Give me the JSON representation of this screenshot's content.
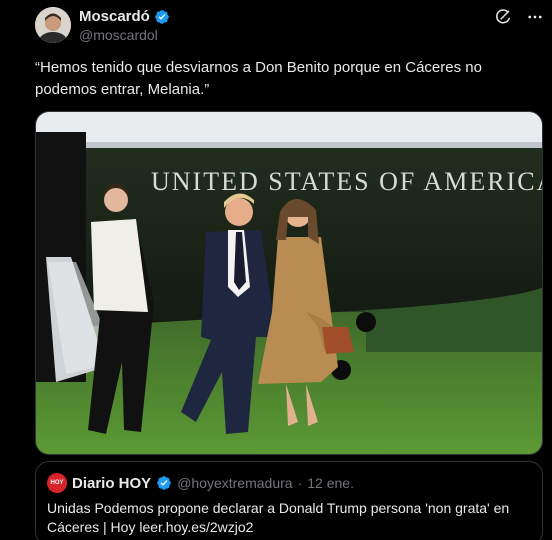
{
  "author": {
    "display_name": "Moscardó",
    "handle": "@moscardol",
    "verified": true
  },
  "tweet": {
    "text": "“Hemos tenido que desviarnos a Don Benito porque en Cáceres no podemos entrar, Melania.”"
  },
  "media": {
    "helicopter_lettering": "UNITED STATES OF AMERICA"
  },
  "quoted": {
    "logo_text": "HOY",
    "name": "Diario HOY",
    "verified": true,
    "handle": "@hoyextremadura",
    "separator": "·",
    "date": "12 ene.",
    "text": "Unidas Podemos propone declarar a Donald Trump persona 'non grata' en Cáceres | Hoy leer.hoy.es/2wzjo2"
  },
  "icons": {
    "top_right": [
      "grok-icon",
      "more-icon"
    ],
    "verified": "verified-badge-icon"
  },
  "colors": {
    "background": "#000000",
    "text": "#e7e9ea",
    "muted": "#71767b",
    "verified": "#1d9bf0",
    "border": "#2f3336",
    "hoy_red": "#d8232a"
  }
}
